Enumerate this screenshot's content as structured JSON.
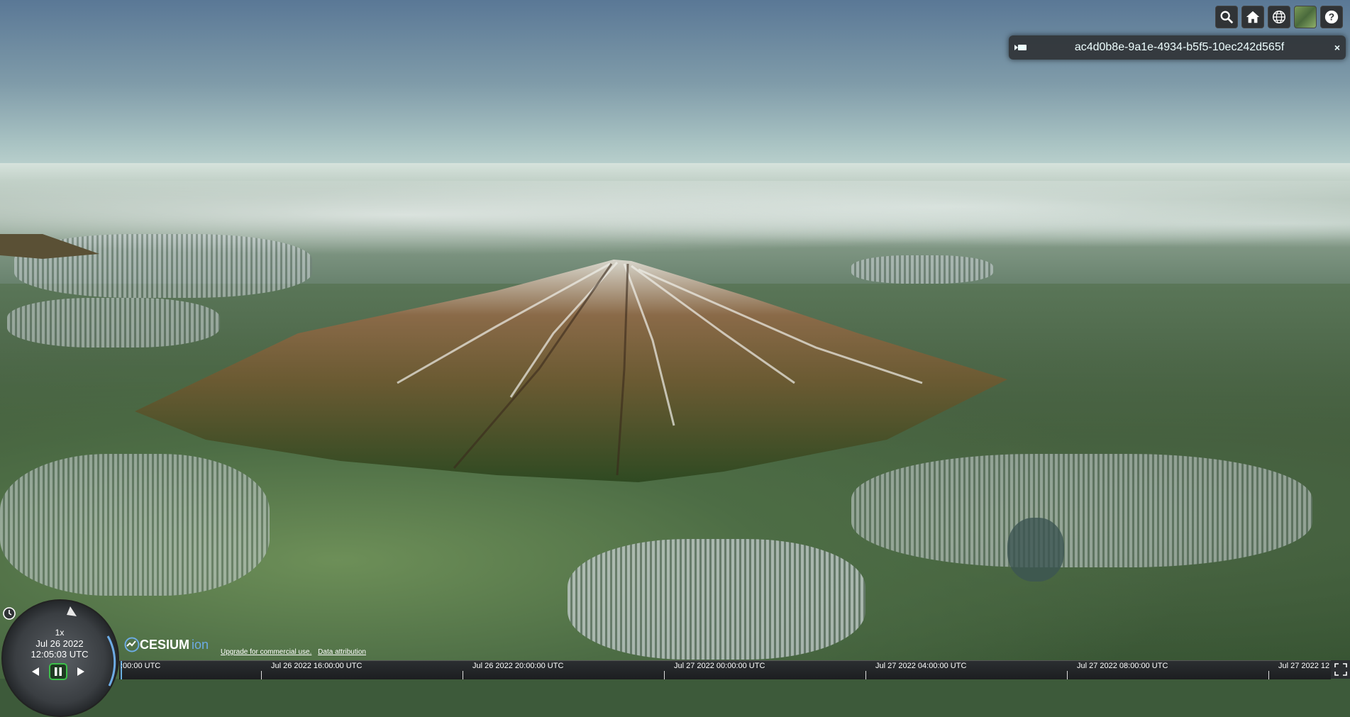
{
  "toolbar": {
    "buttons": [
      {
        "name": "search",
        "icon": "search-icon"
      },
      {
        "name": "home",
        "icon": "home-icon"
      },
      {
        "name": "scene-mode",
        "icon": "globe-icon"
      },
      {
        "name": "base-layer-picker",
        "icon": "imagery-thumbnail"
      },
      {
        "name": "help",
        "icon": "help-icon"
      }
    ]
  },
  "infobox": {
    "title": "ac4d0b8e-9a1e-4934-b5f5-10ec242d565f",
    "close": "×",
    "camera_icon": "camera-icon"
  },
  "animation": {
    "speed": "1x",
    "date": "Jul 26 2022",
    "time": "12:05:03 UTC"
  },
  "logo": {
    "text": "CESIUM",
    "suffix": "ion"
  },
  "credits": {
    "upgrade": "Upgrade for commercial use.",
    "attribution": "Data attribution"
  },
  "timeline": {
    "labels": [
      ":00:00 UTC",
      "Jul 26 2022 16:00:00 UTC",
      "Jul 26 2022 20:00:00 UTC",
      "Jul 27 2022 00:00:00 UTC",
      "Jul 27 2022 04:00:00 UTC",
      "Jul 27 2022 08:00:00 UTC",
      "Jul 27 2022 12"
    ]
  },
  "colors": {
    "widget_bg": "#303336",
    "accent_blue": "#6dabe4",
    "pause_green": "#3dbf4a"
  }
}
